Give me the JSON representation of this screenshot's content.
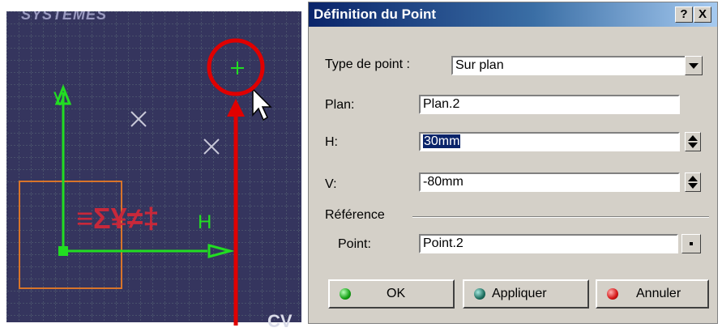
{
  "watermark": {
    "top": "SYSTEMES",
    "bottom": "CV"
  },
  "viewport": {
    "axis_v_label": "V",
    "axis_h_label": "H",
    "symbol_text": "≡Σ¥≠‡"
  },
  "dialog": {
    "title": "Définition du Point",
    "help_label": "?",
    "close_label": "X",
    "type_label": "Type de point :",
    "type_value": "Sur plan",
    "plan_label": "Plan:",
    "plan_value": "Plan.2",
    "h_label": "H:",
    "h_value": "30mm",
    "v_label": "V:",
    "v_value": "-80mm",
    "reference_label": "Référence",
    "point_label": "Point:",
    "point_value": "Point.2",
    "ok_label": "OK",
    "apply_label": "Appliquer",
    "cancel_label": "Annuler"
  },
  "colors": {
    "viewport_bg": "#35355e",
    "axis_green": "#22dd22",
    "annotation_red": "#e00000",
    "selection_blue": "#0a246a"
  }
}
